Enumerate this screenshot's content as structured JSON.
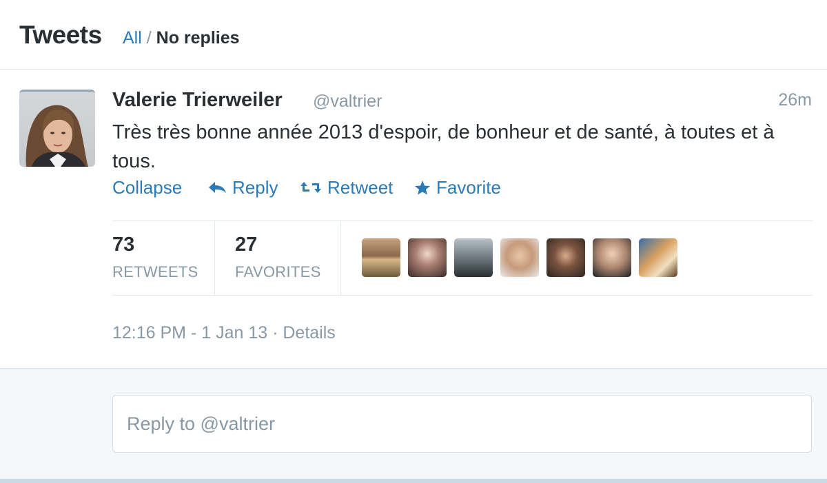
{
  "header": {
    "title": "Tweets",
    "filter_all": "All",
    "separator": "/",
    "filter_no_replies": "No replies"
  },
  "tweet": {
    "name": "Valerie Trierweiler",
    "handle": "@valtrier",
    "time_ago": "26m",
    "text": "Très très bonne année 2013 d'espoir, de bonheur et de santé, à toutes et à tous.",
    "actions": {
      "collapse": "Collapse",
      "reply": "Reply",
      "retweet": "Retweet",
      "favorite": "Favorite"
    },
    "stats": {
      "retweets_count": "73",
      "retweets_label": "RETWEETS",
      "favorites_count": "27",
      "favorites_label": "FAVORITES"
    },
    "meta": {
      "timestamp": "12:16 PM - 1 Jan 13",
      "dot": "·",
      "details": "Details"
    }
  },
  "reply": {
    "placeholder": "Reply to @valtrier"
  },
  "colors": {
    "link": "#2b7bb9",
    "muted": "#8899a6",
    "text": "#292f33",
    "border": "#e1e8ed",
    "footer_bg": "#f5f8fa"
  },
  "icons": [
    "reply-arrow-icon",
    "retweet-icon",
    "star-icon"
  ]
}
